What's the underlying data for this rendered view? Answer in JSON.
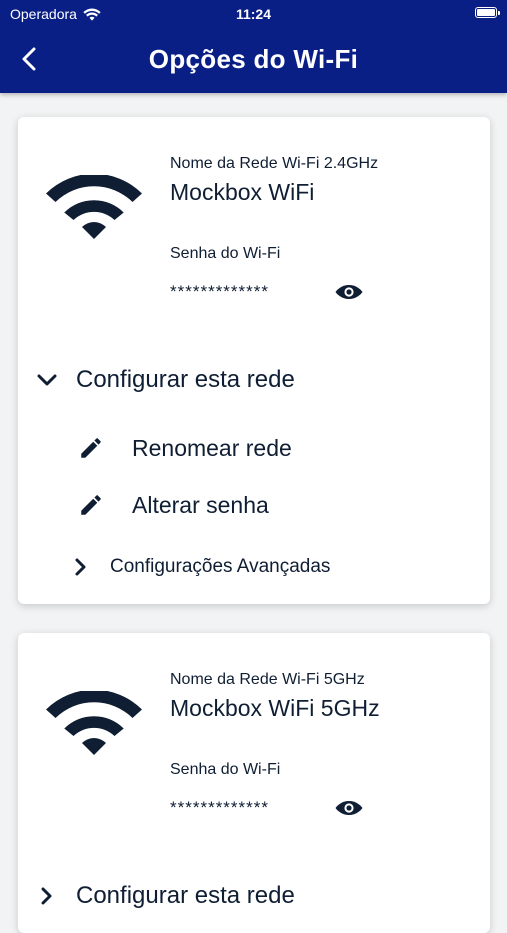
{
  "status_bar": {
    "carrier": "Operadora",
    "time": "11:24"
  },
  "header": {
    "title": "Opções do Wi-Fi",
    "back_icon": "chevron-left-icon"
  },
  "networks": [
    {
      "name_label": "Nome da Rede Wi-Fi 2.4GHz",
      "name": "Mockbox WiFi",
      "password_label": "Senha do Wi-Fi",
      "password_masked": "*************",
      "configure_label": "Configurar esta rede",
      "rename_label": "Renomear rede",
      "change_password_label": "Alterar senha",
      "advanced_label": "Configurações Avançadas"
    },
    {
      "name_label": "Nome da Rede Wi-Fi 5GHz",
      "name": "Mockbox WiFi 5GHz",
      "password_label": "Senha do Wi-Fi",
      "password_masked": "*************",
      "configure_label": "Configurar esta rede"
    }
  ],
  "colors": {
    "header_bg": "#0a1f86",
    "text_primary": "#0f1e33",
    "page_bg": "#f2f3f4"
  }
}
